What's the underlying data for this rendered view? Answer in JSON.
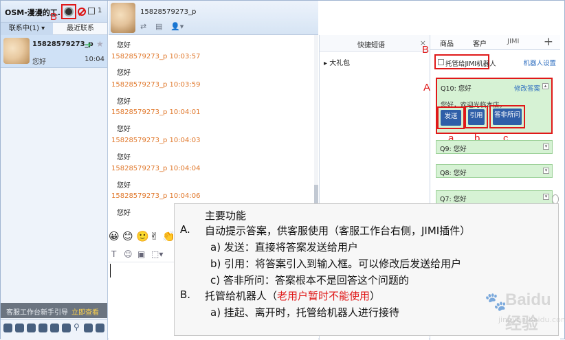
{
  "app": {
    "title": "OSM-漫漫的工...",
    "message_count": "1"
  },
  "left": {
    "tabs": [
      "联系中(1)",
      "最近联系"
    ],
    "contact": {
      "name": "15828579273_p",
      "preview": "您好",
      "time": "10:04"
    },
    "guide": {
      "text": "客服工作台新手引导",
      "link": "立即查看"
    }
  },
  "chat": {
    "name": "15828579273_p",
    "messages": [
      {
        "text": "您好"
      },
      {
        "sender": "15828579273_p",
        "time": "10:03:57",
        "text": "您好"
      },
      {
        "sender": "15828579273_p",
        "time": "10:03:59",
        "text": "您好"
      },
      {
        "sender": "15828579273_p",
        "time": "10:04:01",
        "text": "您好"
      },
      {
        "sender": "15828579273_p",
        "time": "10:04:03",
        "text": "您好"
      },
      {
        "sender": "15828579273_p",
        "time": "10:04:04",
        "text": "您好"
      },
      {
        "sender": "15828579273_p",
        "time": "10:04:06",
        "text": "您好"
      }
    ]
  },
  "quick": {
    "title": "快捷短语",
    "item": "大礼包"
  },
  "right": {
    "tabs": [
      "商品",
      "客户",
      "JIMI"
    ],
    "robot_label": "托管给JIMI机器人",
    "robot_settings": "机器人设置",
    "qa": [
      {
        "q": "Q10: 您好",
        "edit": "修改答案",
        "answer": "您好，欢迎光临本店。"
      },
      {
        "q": "Q9: 您好"
      },
      {
        "q": "Q8: 您好"
      },
      {
        "q": "Q7: 您好"
      }
    ],
    "buttons": {
      "send": "发送",
      "quote": "引用",
      "wrong": "答非所问"
    }
  },
  "marks": {
    "B": "B",
    "A": "A",
    "a": "a",
    "b": "b",
    "c": "c"
  },
  "note": {
    "title": "主要功能",
    "a_head": "A.",
    "a_text": "自动提示答案，供客服使用（客服工作台右侧，JIMI插件）",
    "a1": "a)    发送：直接将答案发送给用户",
    "a2": "b)    引用：将答案引入到输入框。可以修改后发送给用户",
    "a3": "c)    答非所问：答案根本不是回答这个问题的",
    "b_head": "B.",
    "b_text": "托管给机器人（",
    "b_warn": "老用户暂时不能使用",
    "b_close": "）",
    "b1": "a)    挂起、离开时，托管给机器人进行接待"
  },
  "watermark": {
    "text": "Baidu经验",
    "sub": "jingyan.baidu.com"
  }
}
